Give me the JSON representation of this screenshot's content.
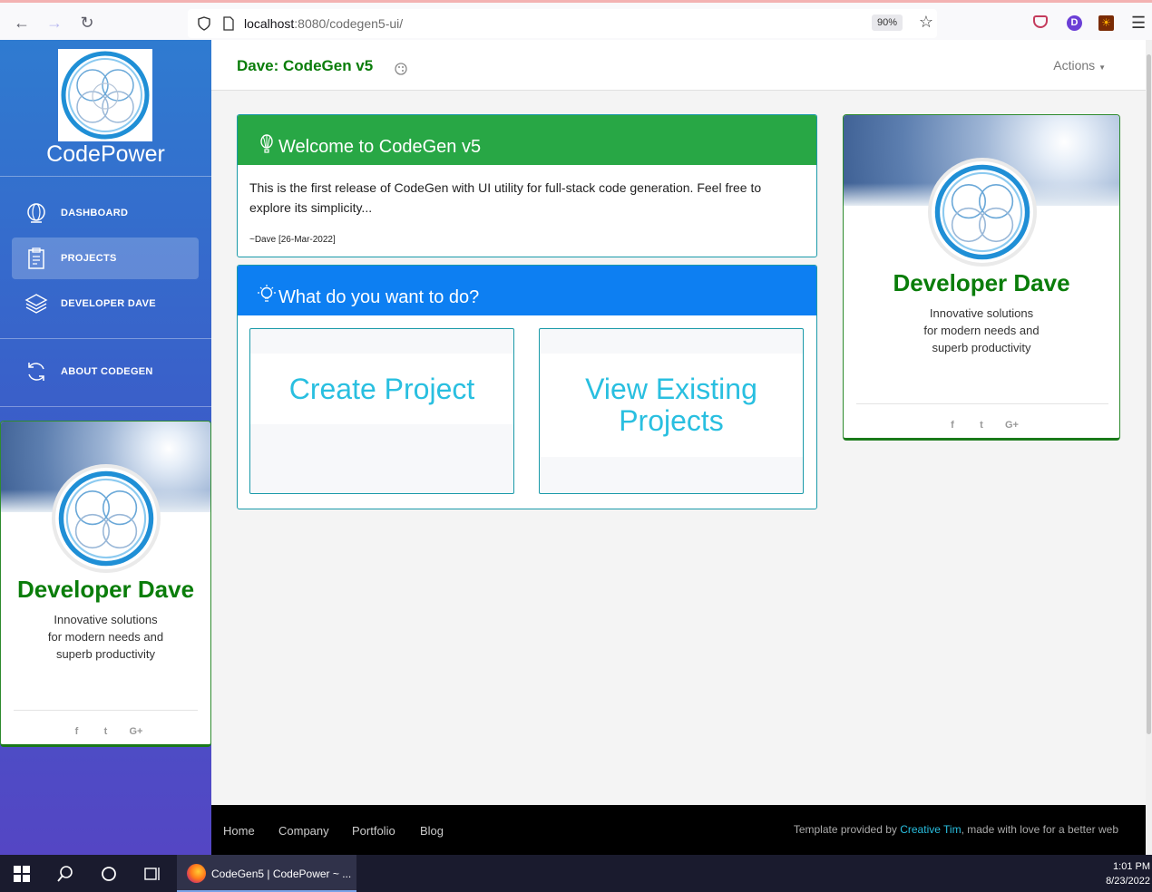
{
  "browser": {
    "url_host": "localhost",
    "url_rest": ":8080/codegen5-ui/",
    "zoom": "90%",
    "profile_initial": "D"
  },
  "sidebar": {
    "brand": "CodePower",
    "items": [
      {
        "label": "DASHBOARD",
        "icon": "globe-icon"
      },
      {
        "label": "PROJECTS",
        "icon": "clipboard-icon",
        "active": true
      },
      {
        "label": "DEVELOPER DAVE",
        "icon": "layers-icon"
      },
      {
        "label": "ABOUT CODEGEN",
        "icon": "refresh-icon"
      }
    ]
  },
  "profile": {
    "name": "Developer Dave",
    "desc_line1": "Innovative solutions",
    "desc_line2": "for modern needs and",
    "desc_line3": "superb productivity"
  },
  "header": {
    "title": "Dave: CodeGen v5",
    "actions_label": "Actions"
  },
  "welcome": {
    "title": "Welcome to CodeGen v5",
    "body": "This is the first release of CodeGen with UI utility for full-stack code generation. Feel free to explore its simplicity...",
    "signature": "~Dave [26-Mar-2022]"
  },
  "todo": {
    "title": "What do you want to do?",
    "create_line1": "Create Project",
    "view_line1": "View Existing",
    "view_line2": "Projects"
  },
  "footer": {
    "links": [
      "Home",
      "Company",
      "Portfolio",
      "Blog"
    ],
    "credit_prefix": "Template provided by ",
    "credit_link": "Creative Tim",
    "credit_suffix": ", made with love for a better web"
  },
  "taskbar": {
    "app_label": "CodeGen5 | CodePower ~ ...",
    "time": "1:01 PM",
    "date": "8/23/2022"
  },
  "colors": {
    "green_header": "#28a745",
    "blue_header": "#0d7ff2",
    "brand_green": "#0a7d0a",
    "tile_text": "#29bfe0"
  }
}
